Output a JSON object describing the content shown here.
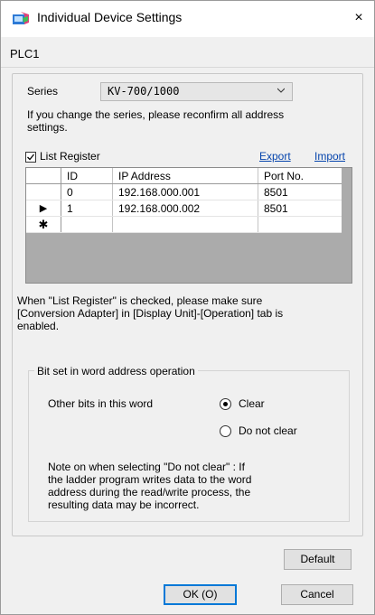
{
  "window": {
    "title": "Individual Device Settings",
    "close_glyph": "×"
  },
  "plc_tab": "PLC1",
  "series": {
    "label": "Series",
    "value": "KV-700/1000"
  },
  "series_note": [
    "If you change the series, please reconfirm all address",
    "settings."
  ],
  "list_register": {
    "label": "List Register",
    "checked": true
  },
  "links": {
    "export": "Export",
    "import": "Import"
  },
  "table": {
    "columns": [
      "ID",
      "IP Address",
      "Port No."
    ],
    "rows": [
      {
        "marker": "",
        "id": "0",
        "ip": "192.168.000.001",
        "port": "8501"
      },
      {
        "marker": "▶",
        "id": "1",
        "ip": "192.168.000.002",
        "port": "8501"
      },
      {
        "marker": "✱",
        "id": "",
        "ip": "",
        "port": ""
      }
    ]
  },
  "list_note": [
    "When \"List Register\" is checked, please make sure",
    "[Conversion Adapter] in [Display Unit]-[Operation] tab is",
    "enabled."
  ],
  "bitset": {
    "title": "Bit set in word address operation",
    "other_bits_label": "Other bits in this word",
    "options": [
      {
        "label": "Clear",
        "selected": true
      },
      {
        "label": "Do not clear",
        "selected": false
      }
    ],
    "note": [
      "Note on when selecting \"Do not clear\" : If",
      "the ladder program writes data to the word",
      "address during the read/write process, the",
      "resulting data may be incorrect."
    ]
  },
  "buttons": {
    "default": "Default",
    "ok": "OK (O)",
    "cancel": "Cancel"
  }
}
